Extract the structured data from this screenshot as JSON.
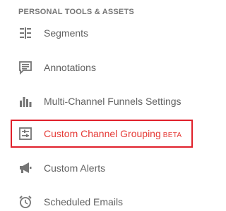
{
  "section": {
    "title": "PERSONAL TOOLS & ASSETS"
  },
  "items": [
    {
      "label": "Segments",
      "icon": "segments-icon"
    },
    {
      "label": "Annotations",
      "icon": "annotation-icon"
    },
    {
      "label": "Multi-Channel Funnels Settings",
      "icon": "bar-chart-icon"
    },
    {
      "label": "Custom Channel Grouping",
      "badge": "BETA",
      "icon": "channel-grouping-icon",
      "active": true
    },
    {
      "label": "Custom Alerts",
      "icon": "megaphone-icon"
    },
    {
      "label": "Scheduled Emails",
      "icon": "alarm-clock-icon"
    }
  ],
  "colors": {
    "text": "#616161",
    "icon": "#757575",
    "active": "#e53935",
    "highlight": "#e0202a"
  }
}
